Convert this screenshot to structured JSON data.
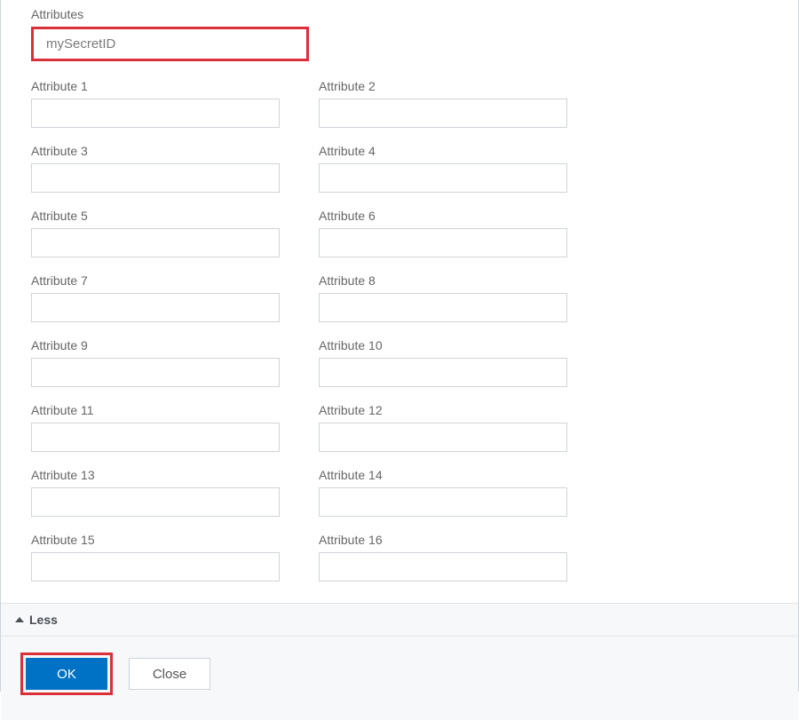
{
  "section": {
    "title": "Attributes",
    "external_value": "mySecretID"
  },
  "attributes": [
    {
      "label": "Attribute 1",
      "value": ""
    },
    {
      "label": "Attribute 2",
      "value": ""
    },
    {
      "label": "Attribute 3",
      "value": ""
    },
    {
      "label": "Attribute 4",
      "value": ""
    },
    {
      "label": "Attribute 5",
      "value": ""
    },
    {
      "label": "Attribute 6",
      "value": ""
    },
    {
      "label": "Attribute 7",
      "value": ""
    },
    {
      "label": "Attribute 8",
      "value": ""
    },
    {
      "label": "Attribute 9",
      "value": ""
    },
    {
      "label": "Attribute 10",
      "value": ""
    },
    {
      "label": "Attribute 11",
      "value": ""
    },
    {
      "label": "Attribute 12",
      "value": ""
    },
    {
      "label": "Attribute 13",
      "value": ""
    },
    {
      "label": "Attribute 14",
      "value": ""
    },
    {
      "label": "Attribute 15",
      "value": ""
    },
    {
      "label": "Attribute 16",
      "value": ""
    }
  ],
  "toggle": {
    "label": "Less"
  },
  "buttons": {
    "ok": "OK",
    "close": "Close"
  }
}
